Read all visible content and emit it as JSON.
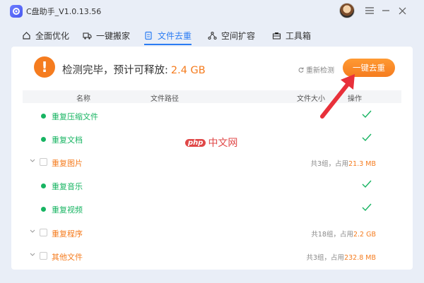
{
  "app": {
    "title": "C盘助手_V1.0.13.56"
  },
  "tabs": [
    {
      "label": "全面优化",
      "icon": "home-icon",
      "active": false
    },
    {
      "label": "一键搬家",
      "icon": "truck-icon",
      "active": false
    },
    {
      "label": "文件去重",
      "icon": "file-dedupe-icon",
      "active": true
    },
    {
      "label": "空间扩容",
      "icon": "expand-icon",
      "active": false
    },
    {
      "label": "工具箱",
      "icon": "toolbox-icon",
      "active": false
    }
  ],
  "scan": {
    "headline": "检测完毕，预计可释放:",
    "size": "2.4 GB",
    "rescan_label": "重新检测",
    "clean_button": "一键去重"
  },
  "table": {
    "headers": {
      "name": "名称",
      "path": "文件路径",
      "size": "文件大小",
      "action": "操作"
    },
    "rows": [
      {
        "label": "重复压缩文件",
        "kind": "green"
      },
      {
        "label": "重复文档",
        "kind": "green"
      },
      {
        "label": "重复图片",
        "kind": "orange",
        "summary_prefix": "共3组，占用",
        "summary_amount": "21.3 MB"
      },
      {
        "label": "重复音乐",
        "kind": "green"
      },
      {
        "label": "重复视频",
        "kind": "green"
      },
      {
        "label": "重复程序",
        "kind": "orange",
        "summary_prefix": "共18组，占用",
        "summary_amount": "2.2 GB"
      },
      {
        "label": "其他文件",
        "kind": "orange",
        "summary_prefix": "共3组，占用",
        "summary_amount": "232.8 MB"
      }
    ]
  },
  "watermark": {
    "badge": "php",
    "text": "中文网"
  },
  "colors": {
    "accent": "#2b7cf3",
    "orange": "#f57c1f",
    "green": "#17b462"
  }
}
